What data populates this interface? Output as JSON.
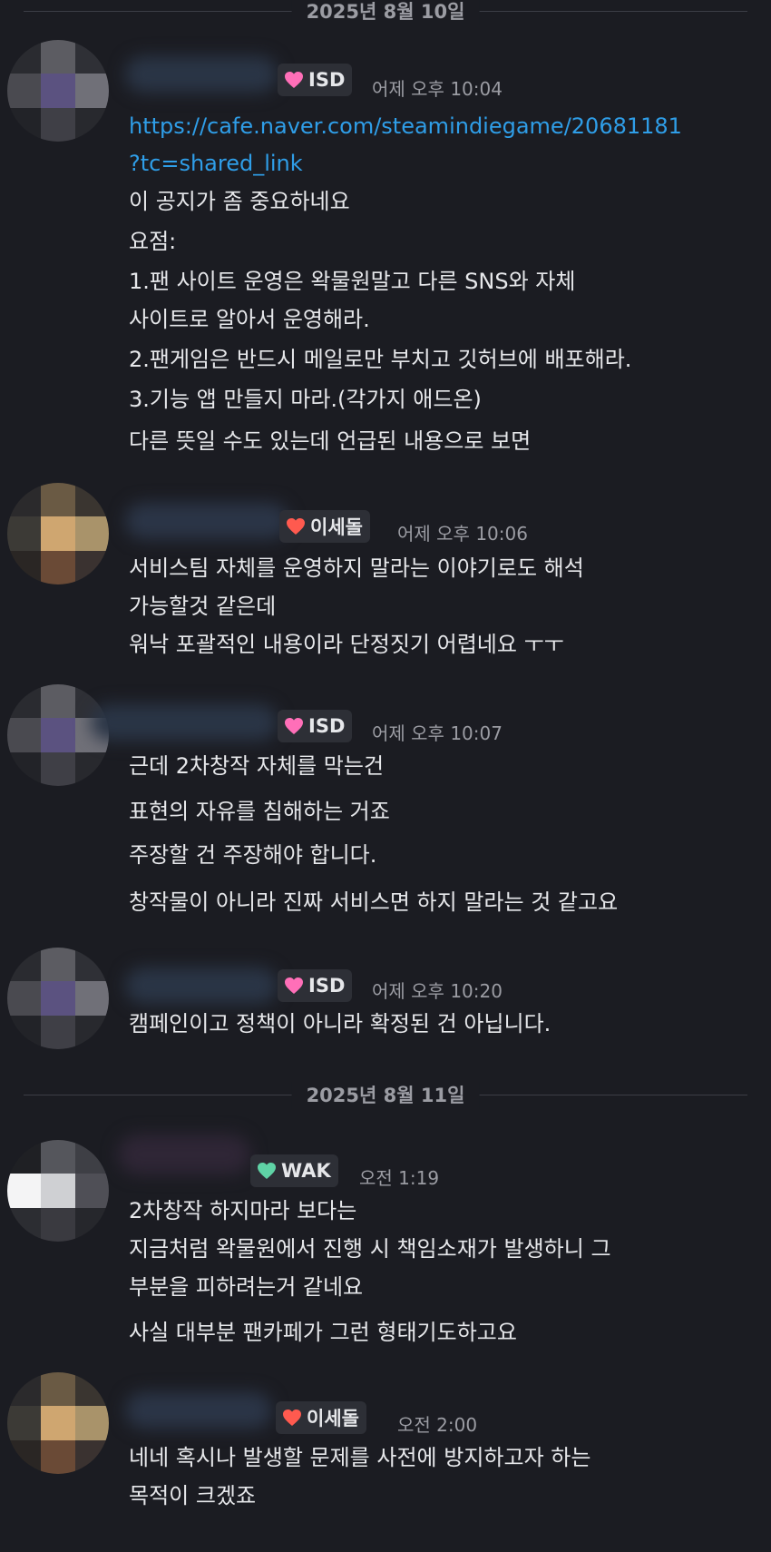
{
  "dates": {
    "first": "2025년 8월 10일",
    "second": "2025년 8월 11일"
  },
  "messages": [
    {
      "badge": "ISD",
      "badge_color": "#ff6fb8",
      "time": "어제 오후 10:04",
      "lines": [
        "https://cafe.naver.com/steamindiegame/20681181",
        "?tc=shared_link",
        "이 공지가 좀 중요하네요",
        "요점:",
        "1.팬 사이트 운영은 왁물원말고 다른 SNS와 자체",
        "사이트로 알아서 운영해라.",
        "2.팬게임은 반드시 메일로만 부치고 깃허브에 배포해라.",
        "3.기능 앱 만들지 마라.(각가지 애드온)",
        "다른 뜻일 수도 있는데 언급된 내용으로 보면"
      ]
    },
    {
      "badge": "이세돌",
      "badge_color": "#ff5a4f",
      "time": "어제 오후 10:06",
      "lines": [
        "서비스팀 자체를 운영하지 말라는 이야기로도 해석",
        "가능할것 같은데",
        "워낙 포괄적인 내용이라 단정짓기 어렵네요 ㅜㅜ"
      ]
    },
    {
      "badge": "ISD",
      "badge_color": "#ff6fb8",
      "time": "어제 오후 10:07",
      "lines": [
        "근데 2차창작 자체를 막는건",
        "표현의 자유를 침해하는 거죠",
        "주장할 건 주장해야 합니다.",
        "창작물이 아니라 진짜 서비스면 하지 말라는 것 같고요"
      ]
    },
    {
      "badge": "ISD",
      "badge_color": "#ff6fb8",
      "time": "어제 오후 10:20",
      "lines": [
        "캠페인이고 정책이 아니라 확정된 건 아닙니다."
      ]
    },
    {
      "badge": "WAK",
      "badge_color": "#5fd3a6",
      "time": "오전 1:19",
      "lines": [
        "2차창작 하지마라 보다는",
        "지금처럼 왁물원에서 진행 시 책임소재가 발생하니 그",
        "부분을 피하려는거 같네요",
        "사실 대부분 팬카페가 그런 형태기도하고요"
      ]
    },
    {
      "badge": "이세돌",
      "badge_color": "#ff5a4f",
      "time": "오전 2:00",
      "lines": [
        "네네 혹시나 발생할 문제를 사전에 방지하고자 하는",
        "목적이 크겠죠"
      ]
    }
  ]
}
